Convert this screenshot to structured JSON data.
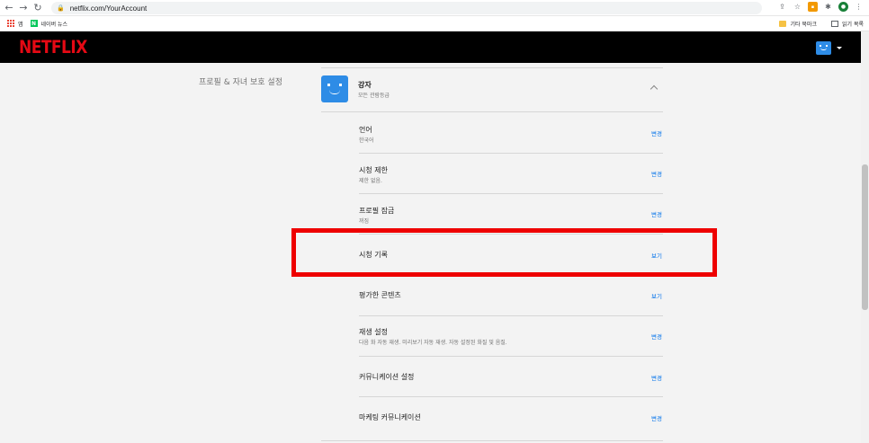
{
  "browser": {
    "url": "netflix.com/YourAccount",
    "bookmarks": [
      {
        "label": "앱",
        "icon": "apps-grid-icon"
      },
      {
        "label": "네이버 뉴스",
        "icon": "naver-icon"
      }
    ],
    "bookmarks_right": [
      {
        "label": "기타 북마크",
        "icon": "folder-icon"
      },
      {
        "label": "읽기 목록",
        "icon": "reading-list-icon"
      }
    ]
  },
  "header": {
    "logo": "NETFLIX"
  },
  "section": {
    "title": "프로필 & 자녀 보호 설정"
  },
  "profile": {
    "name": "강자",
    "rating": "모든 관람등급"
  },
  "settings": [
    {
      "label": "언어",
      "sub": "한국어",
      "action": "변경"
    },
    {
      "label": "시청 제한",
      "sub": "제한 없음.",
      "action": "변경"
    },
    {
      "label": "프로필 잠금",
      "sub": "꺼짐",
      "action": "변경"
    },
    {
      "label": "시청 기록",
      "sub": "",
      "action": "보기"
    },
    {
      "label": "평가한 콘텐츠",
      "sub": "",
      "action": "보기"
    },
    {
      "label": "재생 설정",
      "sub": "다음 화 자동 재생. 미리보기 자동 재생. 자동 설정된 화질 및 음질.",
      "action": "변경"
    },
    {
      "label": "커뮤니케이션 설정",
      "sub": "",
      "action": "변경"
    },
    {
      "label": "마케팅 커뮤니케이션",
      "sub": "",
      "action": "변경"
    }
  ],
  "colors": {
    "netflix_red": "#e50914",
    "link_blue": "#0071eb",
    "highlight": "#ee0000",
    "avatar_blue": "#2e8ce6"
  }
}
